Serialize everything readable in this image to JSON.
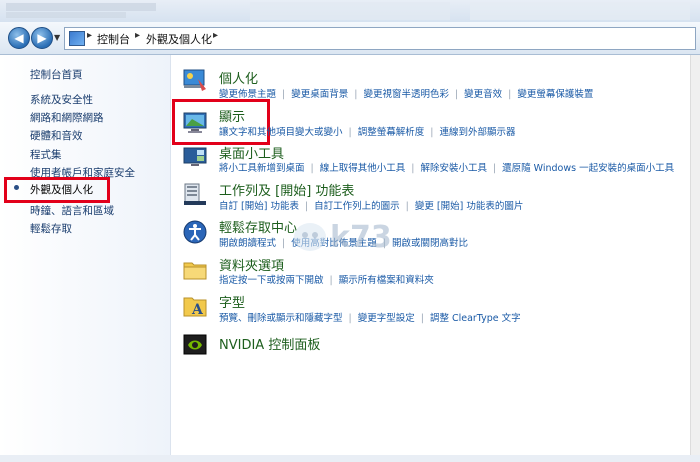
{
  "breadcrumb": [
    "控制台",
    "外觀及個人化"
  ],
  "sidebar": {
    "items": [
      {
        "label": "控制台首頁"
      },
      {
        "label": "系統及安全性"
      },
      {
        "label": "網路和網際網路"
      },
      {
        "label": "硬體和音效"
      },
      {
        "label": "程式集"
      },
      {
        "label": "使用者帳戶和家庭安全"
      },
      {
        "label": "外觀及個人化",
        "selected": true
      },
      {
        "label": "時鐘、語言和區域"
      },
      {
        "label": "輕鬆存取"
      }
    ]
  },
  "categories": [
    {
      "title": "個人化",
      "icon": "personalization-icon",
      "links": [
        "變更佈景主題",
        "變更桌面背景",
        "變更視窗半透明色彩",
        "變更音效",
        "變更螢幕保護裝置"
      ]
    },
    {
      "title": "顯示",
      "icon": "display-icon",
      "links": [
        "讓文字和其他項目變大或變小",
        "調整螢幕解析度",
        "連線到外部顯示器"
      ]
    },
    {
      "title": "桌面小工具",
      "icon": "gadgets-icon",
      "links": [
        "將小工具新增到桌面",
        "線上取得其他小工具",
        "解除安裝小工具",
        "還原隨 Windows 一起安裝的桌面小工具"
      ]
    },
    {
      "title": "工作列及 [開始] 功能表",
      "icon": "taskbar-icon",
      "links": [
        "自訂 [開始] 功能表",
        "自訂工作列上的圖示",
        "變更 [開始] 功能表的圖片"
      ]
    },
    {
      "title": "輕鬆存取中心",
      "icon": "ease-of-access-icon",
      "links": [
        "開啟朗讀程式",
        "使用高對比佈景主題",
        "開啟或關閉高對比"
      ]
    },
    {
      "title": "資料夾選項",
      "icon": "folder-options-icon",
      "links": [
        "指定按一下或按兩下開啟",
        "顯示所有檔案和資料夾"
      ]
    },
    {
      "title": "字型",
      "icon": "fonts-icon",
      "links": [
        "預覽、刪除或顯示和隱藏字型",
        "變更字型設定",
        "調整 ClearType 文字"
      ]
    },
    {
      "title": "NVIDIA 控制面板",
      "icon": "nvidia-icon",
      "links": []
    }
  ],
  "watermark": "k73"
}
